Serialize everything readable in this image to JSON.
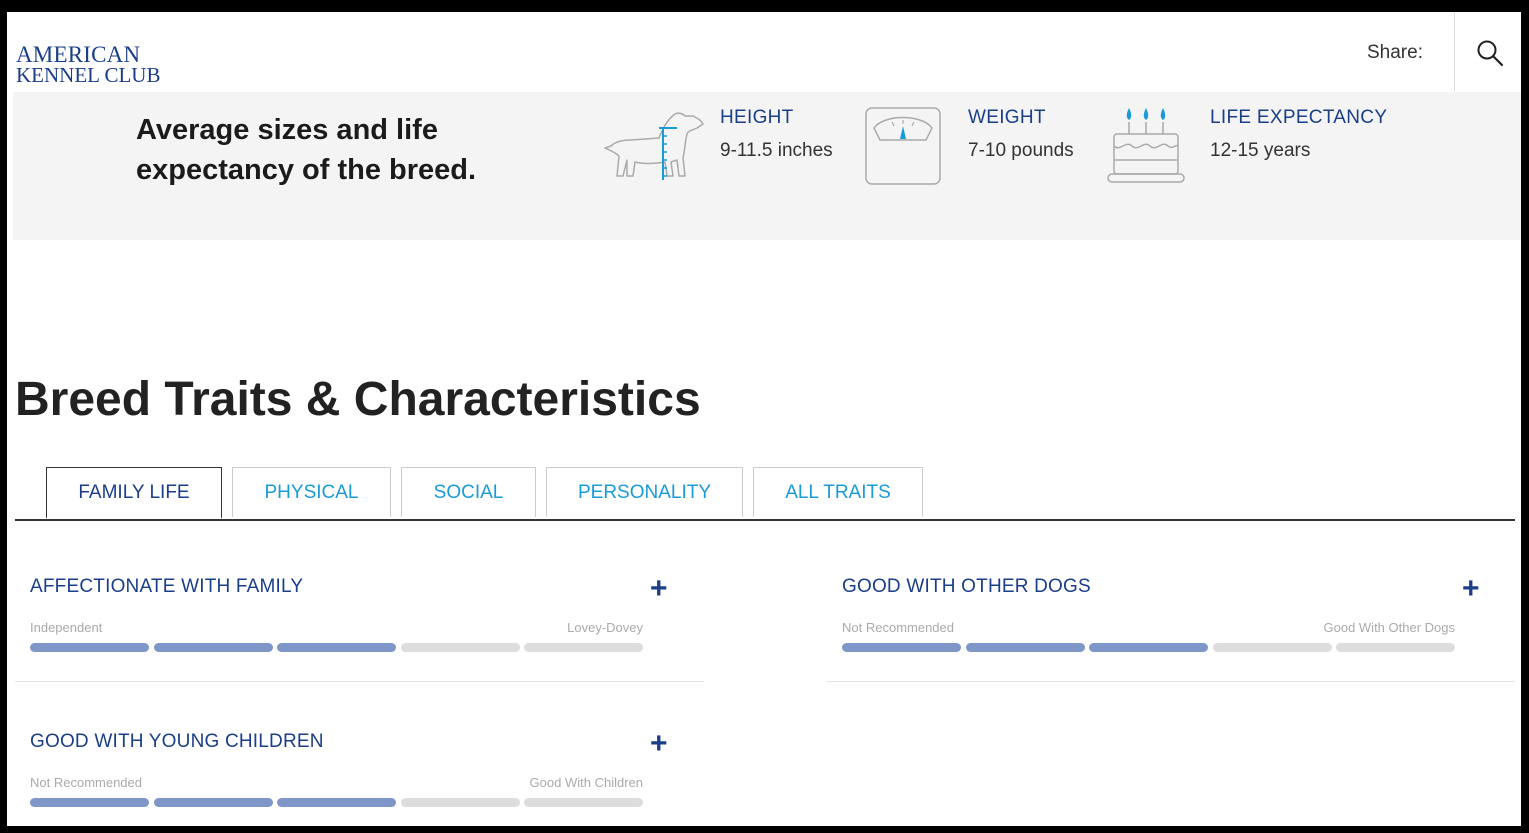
{
  "header": {
    "logo_line1": "AMERICAN",
    "logo_line2": "KENNEL CLUB",
    "share_label": "Share:",
    "search_icon": "search-icon"
  },
  "stats": {
    "title": "Average sizes and life expectancy of the breed.",
    "height": {
      "label": "HEIGHT",
      "value": "9-11.5 inches",
      "icon": "dog-height-icon"
    },
    "weight": {
      "label": "WEIGHT",
      "value": "7-10 pounds",
      "icon": "scale-icon"
    },
    "life": {
      "label": "LIFE EXPECTANCY",
      "value": "12-15 years",
      "icon": "birthday-cake-icon"
    }
  },
  "traits": {
    "title": "Breed Traits & Characteristics",
    "tabs": [
      {
        "label": "FAMILY LIFE",
        "active": true
      },
      {
        "label": "PHYSICAL",
        "active": false
      },
      {
        "label": "SOCIAL",
        "active": false
      },
      {
        "label": "PERSONALITY",
        "active": false
      },
      {
        "label": "ALL TRAITS",
        "active": false
      }
    ],
    "items": [
      {
        "title": "AFFECTIONATE WITH FAMILY",
        "low": "Independent",
        "high": "Lovey-Dovey",
        "rating": 3,
        "max": 5
      },
      {
        "title": "GOOD WITH OTHER DOGS",
        "low": "Not Recommended",
        "high": "Good With Other Dogs",
        "rating": 3,
        "max": 5
      },
      {
        "title": "GOOD WITH YOUNG CHILDREN",
        "low": "Not Recommended",
        "high": "Good With Children",
        "rating": 3,
        "max": 5
      }
    ],
    "expand_symbol": "+"
  },
  "colors": {
    "brand_blue": "#1a3e8a",
    "link_blue": "#1a9bd7",
    "bar_on": "#7f97c8",
    "bar_off": "#dddddd"
  }
}
